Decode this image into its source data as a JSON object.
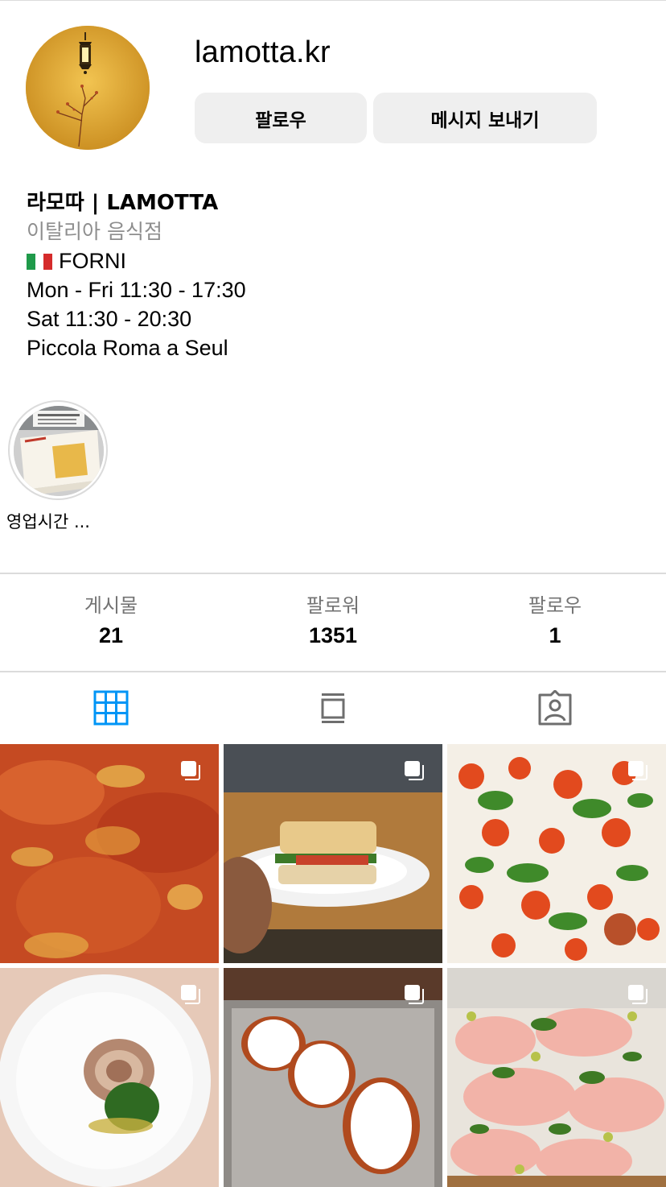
{
  "profile": {
    "username": "lamotta.kr",
    "follow_label": "팔로우",
    "message_label": "메시지 보내기"
  },
  "bio": {
    "name": "라모따 | LAMOTTA",
    "category": "이탈리아 음식점",
    "line_forni": "FORNI",
    "line_weekday": "Mon - Fri 11:30 - 17:30",
    "line_sat": "Sat 11:30 - 20:30",
    "line_tagline": "Piccola Roma a Seul"
  },
  "highlight": {
    "label": "영업시간 ..."
  },
  "stats": {
    "posts_label": "게시물",
    "posts_count": "21",
    "followers_label": "팔로워",
    "followers_count": "1351",
    "following_label": "팔로우",
    "following_count": "1"
  },
  "tabs": [
    {
      "icon": "grid-icon",
      "active": true
    },
    {
      "icon": "reels-icon",
      "active": false
    },
    {
      "icon": "tagged-icon",
      "active": false
    }
  ],
  "posts": [
    {
      "subject": "pizza-rossa-closeup",
      "multi": true
    },
    {
      "subject": "sandwich-on-plate",
      "multi": true
    },
    {
      "subject": "tomato-burrata-pesto-pizza",
      "multi": true
    },
    {
      "subject": "porchetta-with-salsa-verde",
      "multi": true
    },
    {
      "subject": "cream-filled-buns",
      "multi": true
    },
    {
      "subject": "mortadella-pistachio-pizza",
      "multi": true
    }
  ],
  "colors": {
    "accent": "#0095f6",
    "button_bg": "#efefef",
    "secondary_text": "#8e8e8e",
    "divider": "#dbdbdb"
  }
}
